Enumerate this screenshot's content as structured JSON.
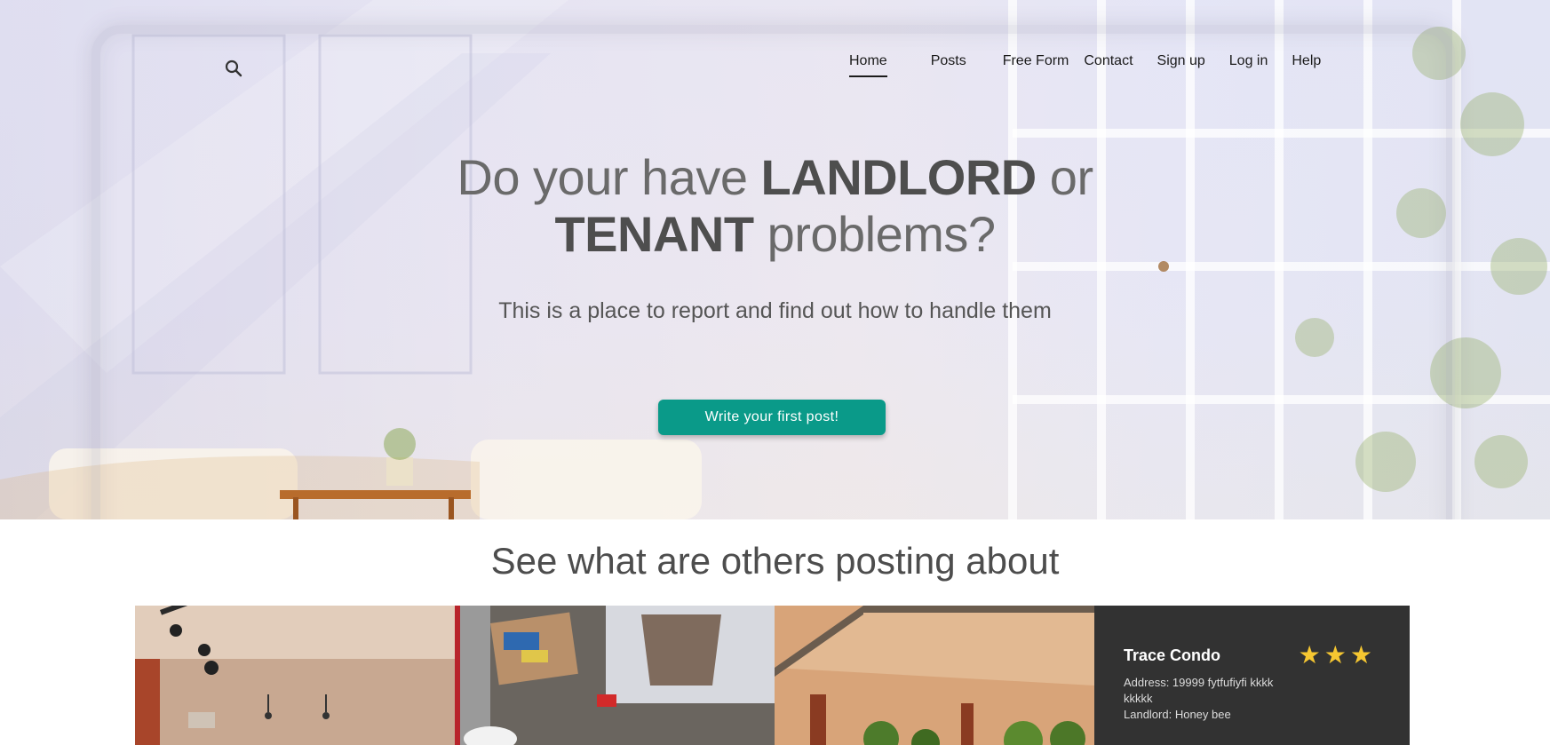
{
  "nav": {
    "items": [
      {
        "label": "Home",
        "active": true
      },
      {
        "label": "Posts",
        "active": false
      },
      {
        "label": "Free Form",
        "active": false
      },
      {
        "label": "Contact",
        "active": false
      },
      {
        "label": "Sign up",
        "active": false
      },
      {
        "label": "Log in",
        "active": false
      },
      {
        "label": "Help",
        "active": false
      }
    ],
    "search_icon": "search-icon"
  },
  "hero": {
    "title_part1": "Do your have ",
    "title_bold1": "LANDLORD",
    "title_part2": " or",
    "title_bold2": "TENANT",
    "title_part3": " problems?",
    "subtitle": "This is a place to report and find out how to handle them",
    "cta_label": "Write your first post!"
  },
  "section": {
    "title": "See what are others posting about"
  },
  "featured_post": {
    "name": "Trace Condo",
    "address": "Address: 19999 fytfufiyfi kkkkkkkkk",
    "landlord": "Landlord: Honey bee",
    "rating": 3
  },
  "colors": {
    "accent": "#0a9a89",
    "card_bg": "#323232",
    "star": "#f6c731"
  }
}
